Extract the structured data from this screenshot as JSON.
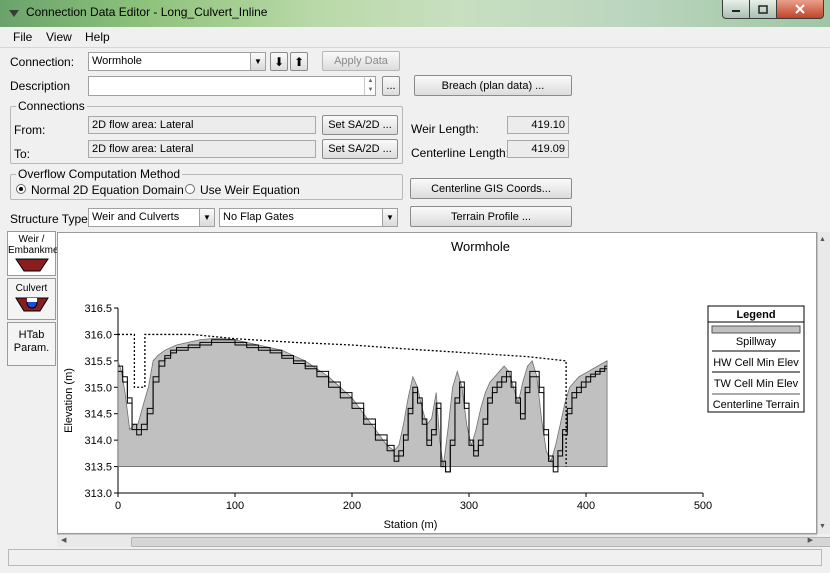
{
  "window": {
    "title": "Connection Data Editor - Long_Culvert_Inline",
    "icon": "chevron-down-icon",
    "controls": {
      "minimize": "minimize-icon",
      "maximize": "maximize-icon",
      "close": "close-icon"
    }
  },
  "menu": [
    "File",
    "View",
    "Help"
  ],
  "connection": {
    "label": "Connection:",
    "value": "Wormhole",
    "down_arrow": "⬇",
    "up_arrow": "⬆",
    "apply_label": "Apply Data"
  },
  "description": {
    "label": "Description",
    "value": "",
    "more_label": "..."
  },
  "breach_label": "Breach (plan data) ...",
  "connections_group": {
    "title": "Connections",
    "from_label": "From:",
    "from_value": "2D flow area: Lateral",
    "to_label": "To:",
    "to_value": "2D flow area: Lateral",
    "set_label": "Set SA/2D ..."
  },
  "weir_length": {
    "label": "Weir Length:",
    "value": "419.10"
  },
  "centerline_length": {
    "label": "Centerline Length:",
    "value": "419.09"
  },
  "overflow": {
    "title": "Overflow Computation Method",
    "options": [
      "Normal 2D Equation Domain",
      "Use Weir Equation"
    ],
    "selected": 0
  },
  "centerline_gis_label": "Centerline GIS Coords...",
  "structure_type": {
    "label": "Structure Type:",
    "value": "Weir and Culverts"
  },
  "flap_gates": {
    "value": "No Flap Gates"
  },
  "terrain_profile_label": "Terrain Profile ...",
  "side_tabs": [
    {
      "label": "Weir / Embankment",
      "icon": "weir-icon"
    },
    {
      "label": "Culvert",
      "icon": "culvert-icon"
    },
    {
      "label": "HTab Param.",
      "icon": ""
    }
  ],
  "legend": {
    "title": "Legend",
    "items": [
      "Spillway",
      "HW Cell Min Elev",
      "TW Cell Min Elev",
      "Centerline Terrain"
    ]
  },
  "colors": {
    "spillway_fill": "#c0c0c0",
    "line": "#000000",
    "terrain": "#555555",
    "culvert_blue": "#1e4ed8",
    "weir_red": "#8a1e1e"
  },
  "chart_data": {
    "type": "area",
    "title": "Wormhole",
    "xlabel": "Station (m)",
    "ylabel": "Elevation (m)",
    "xlim": [
      0,
      500
    ],
    "ylim": [
      313.0,
      316.5
    ],
    "xticks": [
      0,
      100,
      200,
      300,
      400,
      500
    ],
    "yticks": [
      313.0,
      313.5,
      314.0,
      314.5,
      315.0,
      315.5,
      316.0,
      316.5
    ],
    "legend_position": "right",
    "series": [
      {
        "name": "Spillway",
        "x": [
          0,
          3,
          6,
          10,
          14,
          17,
          22,
          26,
          30,
          34,
          40,
          50,
          60,
          70,
          80,
          90,
          100,
          110,
          120,
          130,
          140,
          150,
          160,
          170,
          180,
          190,
          200,
          210,
          220,
          230,
          236,
          240,
          244,
          248,
          252,
          256,
          260,
          264,
          268,
          272,
          275,
          278,
          282,
          286,
          290,
          294,
          298,
          302,
          306,
          310,
          314,
          318,
          322,
          326,
          330,
          334,
          338,
          342,
          346,
          350,
          354,
          358,
          362,
          366,
          370,
          374,
          378,
          382,
          386,
          390,
          394,
          398,
          402,
          406,
          410,
          414,
          418
        ],
        "y": [
          315.5,
          315.3,
          314.9,
          314.2,
          314.3,
          314.3,
          314.7,
          315.0,
          315.5,
          315.6,
          315.7,
          315.8,
          315.85,
          315.9,
          315.92,
          315.92,
          315.9,
          315.85,
          315.8,
          315.75,
          315.7,
          315.6,
          315.5,
          315.35,
          315.2,
          315.0,
          314.8,
          314.5,
          314.2,
          313.9,
          313.8,
          313.9,
          314.3,
          314.8,
          315.2,
          315.0,
          314.6,
          314.3,
          314.4,
          314.9,
          314.0,
          313.5,
          314.2,
          315.0,
          315.3,
          315.0,
          314.3,
          313.9,
          314.2,
          314.6,
          314.9,
          315.1,
          315.2,
          315.3,
          315.4,
          315.3,
          315.0,
          314.7,
          315.1,
          315.4,
          315.5,
          315.2,
          314.4,
          313.8,
          313.6,
          313.9,
          314.3,
          314.7,
          315.0,
          315.1,
          315.2,
          315.25,
          315.3,
          315.35,
          315.4,
          315.45,
          315.5
        ]
      },
      {
        "name": "HW Cell Min Elev",
        "x": [
          0,
          4,
          8,
          12,
          16,
          20,
          25,
          30,
          35,
          40,
          45,
          50,
          60,
          70,
          80,
          90,
          100,
          110,
          120,
          130,
          140,
          150,
          160,
          170,
          180,
          190,
          200,
          210,
          220,
          230,
          236,
          240,
          244,
          248,
          252,
          256,
          260,
          264,
          268,
          272,
          276,
          280,
          284,
          288,
          292,
          296,
          300,
          304,
          308,
          312,
          316,
          320,
          324,
          328,
          332,
          336,
          340,
          344,
          348,
          352,
          356,
          360,
          364,
          368,
          372,
          376,
          380,
          384,
          388,
          392,
          396,
          400,
          404,
          408,
          412,
          416,
          418
        ],
        "y": [
          315.4,
          315.2,
          314.8,
          314.3,
          314.2,
          314.3,
          314.6,
          315.2,
          315.5,
          315.6,
          315.7,
          315.75,
          315.8,
          315.85,
          315.9,
          315.9,
          315.85,
          315.8,
          315.75,
          315.7,
          315.6,
          315.5,
          315.4,
          315.3,
          315.1,
          314.9,
          314.7,
          314.4,
          314.1,
          313.9,
          313.7,
          313.8,
          314.1,
          314.6,
          315.0,
          314.8,
          314.4,
          314.0,
          314.2,
          314.7,
          313.6,
          313.4,
          314.0,
          314.8,
          315.1,
          314.7,
          314.0,
          313.8,
          314.0,
          314.4,
          314.8,
          315.0,
          315.1,
          315.2,
          315.3,
          315.1,
          314.8,
          314.5,
          315.0,
          315.3,
          315.3,
          315.0,
          314.2,
          313.7,
          313.5,
          313.8,
          314.2,
          314.6,
          314.9,
          315.0,
          315.1,
          315.2,
          315.25,
          315.3,
          315.35,
          315.4,
          315.4
        ]
      },
      {
        "name": "TW Cell Min Elev",
        "x": [
          0,
          4,
          8,
          12,
          16,
          20,
          25,
          30,
          35,
          40,
          45,
          50,
          60,
          70,
          80,
          90,
          100,
          110,
          120,
          130,
          140,
          150,
          160,
          170,
          180,
          190,
          200,
          210,
          220,
          230,
          236,
          240,
          244,
          248,
          252,
          256,
          260,
          264,
          268,
          272,
          276,
          280,
          284,
          288,
          292,
          296,
          300,
          304,
          308,
          312,
          316,
          320,
          324,
          328,
          332,
          336,
          340,
          344,
          348,
          352,
          356,
          360,
          364,
          368,
          372,
          376,
          380,
          384,
          388,
          392,
          396,
          400,
          404,
          408,
          412,
          416,
          418
        ],
        "y": [
          315.3,
          315.1,
          314.7,
          314.2,
          314.1,
          314.2,
          314.5,
          315.1,
          315.4,
          315.55,
          315.65,
          315.7,
          315.75,
          315.8,
          315.85,
          315.85,
          315.8,
          315.75,
          315.7,
          315.65,
          315.55,
          315.45,
          315.35,
          315.2,
          315.0,
          314.8,
          314.6,
          314.3,
          314.0,
          313.8,
          313.6,
          313.7,
          314.0,
          314.5,
          314.9,
          314.7,
          314.3,
          313.9,
          314.1,
          314.6,
          313.5,
          313.4,
          313.9,
          314.7,
          315.0,
          314.6,
          313.9,
          313.7,
          313.9,
          314.3,
          314.7,
          314.9,
          315.0,
          315.1,
          315.2,
          315.0,
          314.7,
          314.4,
          314.9,
          315.2,
          315.2,
          314.9,
          314.1,
          313.6,
          313.4,
          313.7,
          314.1,
          314.5,
          314.8,
          314.9,
          315.0,
          315.1,
          315.2,
          315.25,
          315.3,
          315.35,
          315.35
        ]
      },
      {
        "name": "Centerline Terrain",
        "x": [
          0,
          14,
          14,
          23,
          23,
          63,
          100,
          150,
          200,
          250,
          300,
          350,
          383,
          383
        ],
        "y": [
          316.0,
          316.0,
          315.0,
          315.0,
          316.0,
          316.0,
          315.92,
          315.85,
          315.8,
          315.72,
          315.65,
          315.58,
          315.5,
          313.5
        ]
      }
    ]
  }
}
